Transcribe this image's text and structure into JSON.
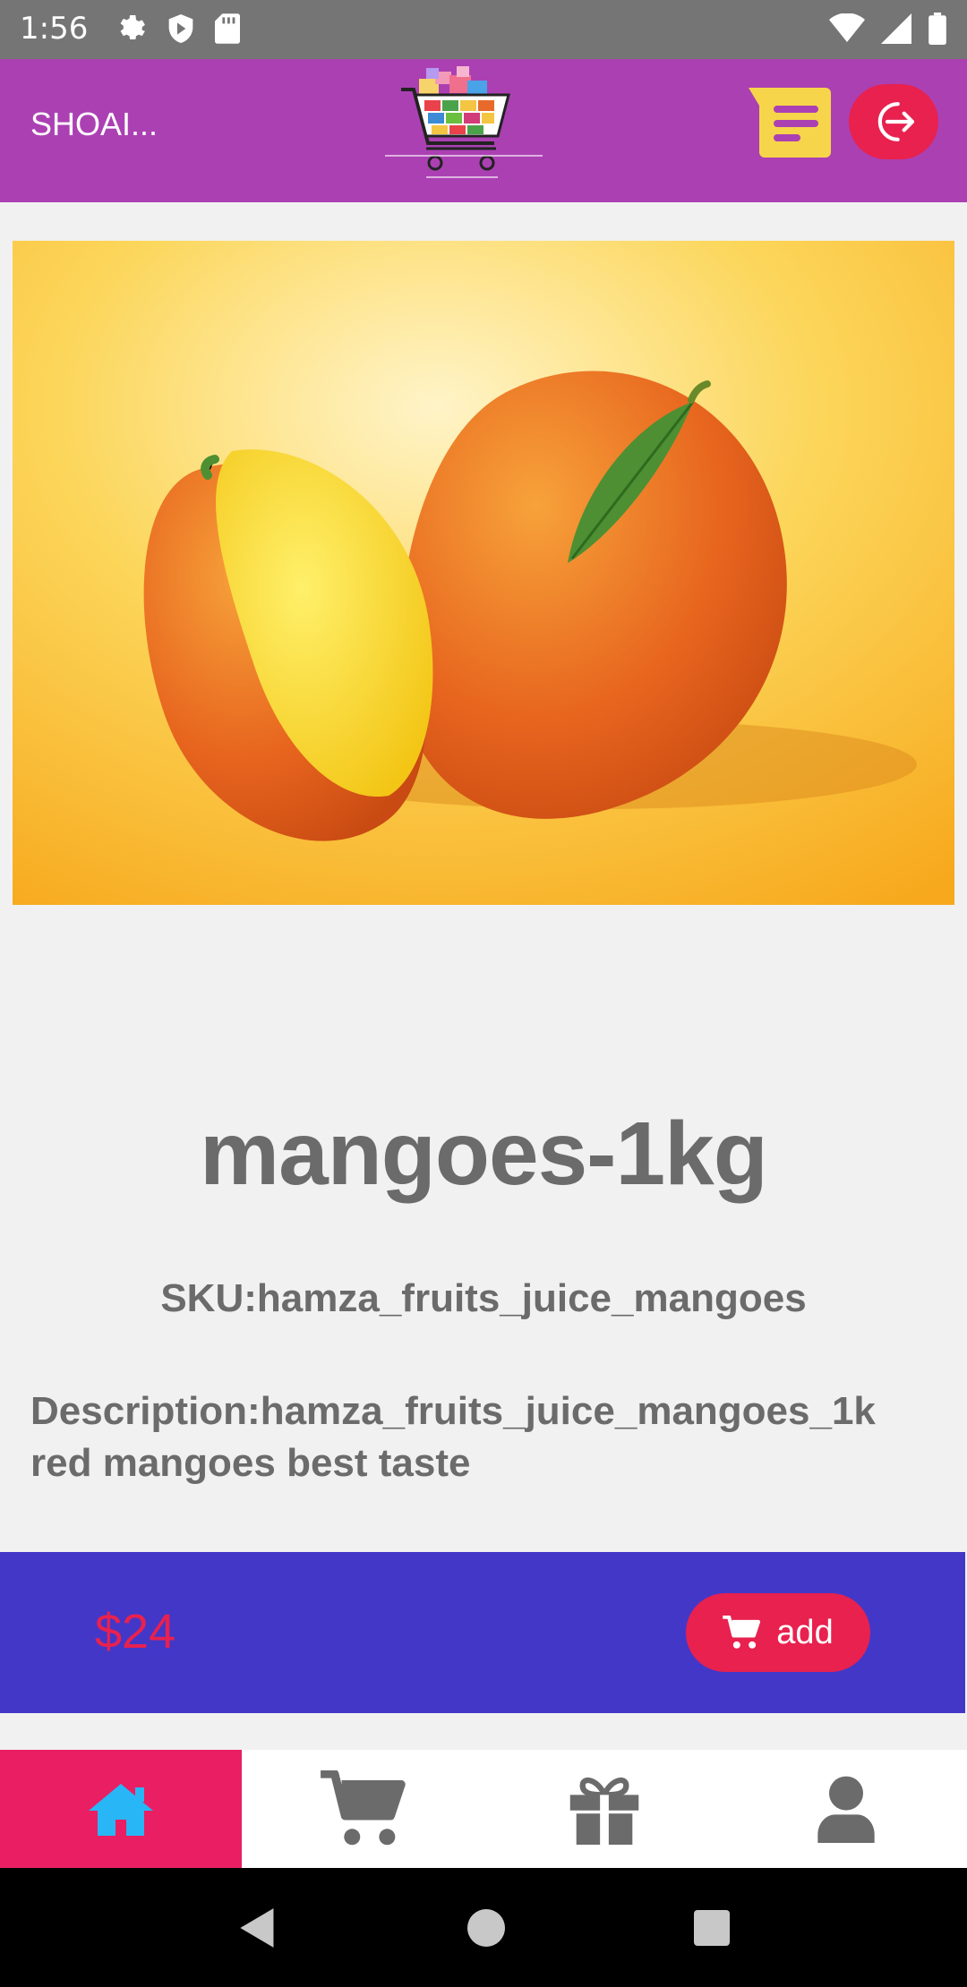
{
  "status_bar": {
    "time": "1:56"
  },
  "header": {
    "user_name": "SHOAI..."
  },
  "product": {
    "title": "mangoes-1kg",
    "sku": "SKU:hamza_fruits_juice_mangoes",
    "description_line1": "Description:hamza_fruits_juice_mangoes_1k",
    "description_line2": "red mangoes best taste",
    "price": "$24",
    "add_label": "add"
  },
  "nav": {
    "items": [
      "home-icon",
      "cart-icon",
      "gift-icon",
      "user-icon"
    ],
    "active": 0
  },
  "colors": {
    "app_bar": "#ab40b3",
    "accent": "#e8214f",
    "price_bar": "#4337c8",
    "active_tab": "#e91e63",
    "active_icon": "#29b6f6",
    "text": "#6b6b6b"
  }
}
